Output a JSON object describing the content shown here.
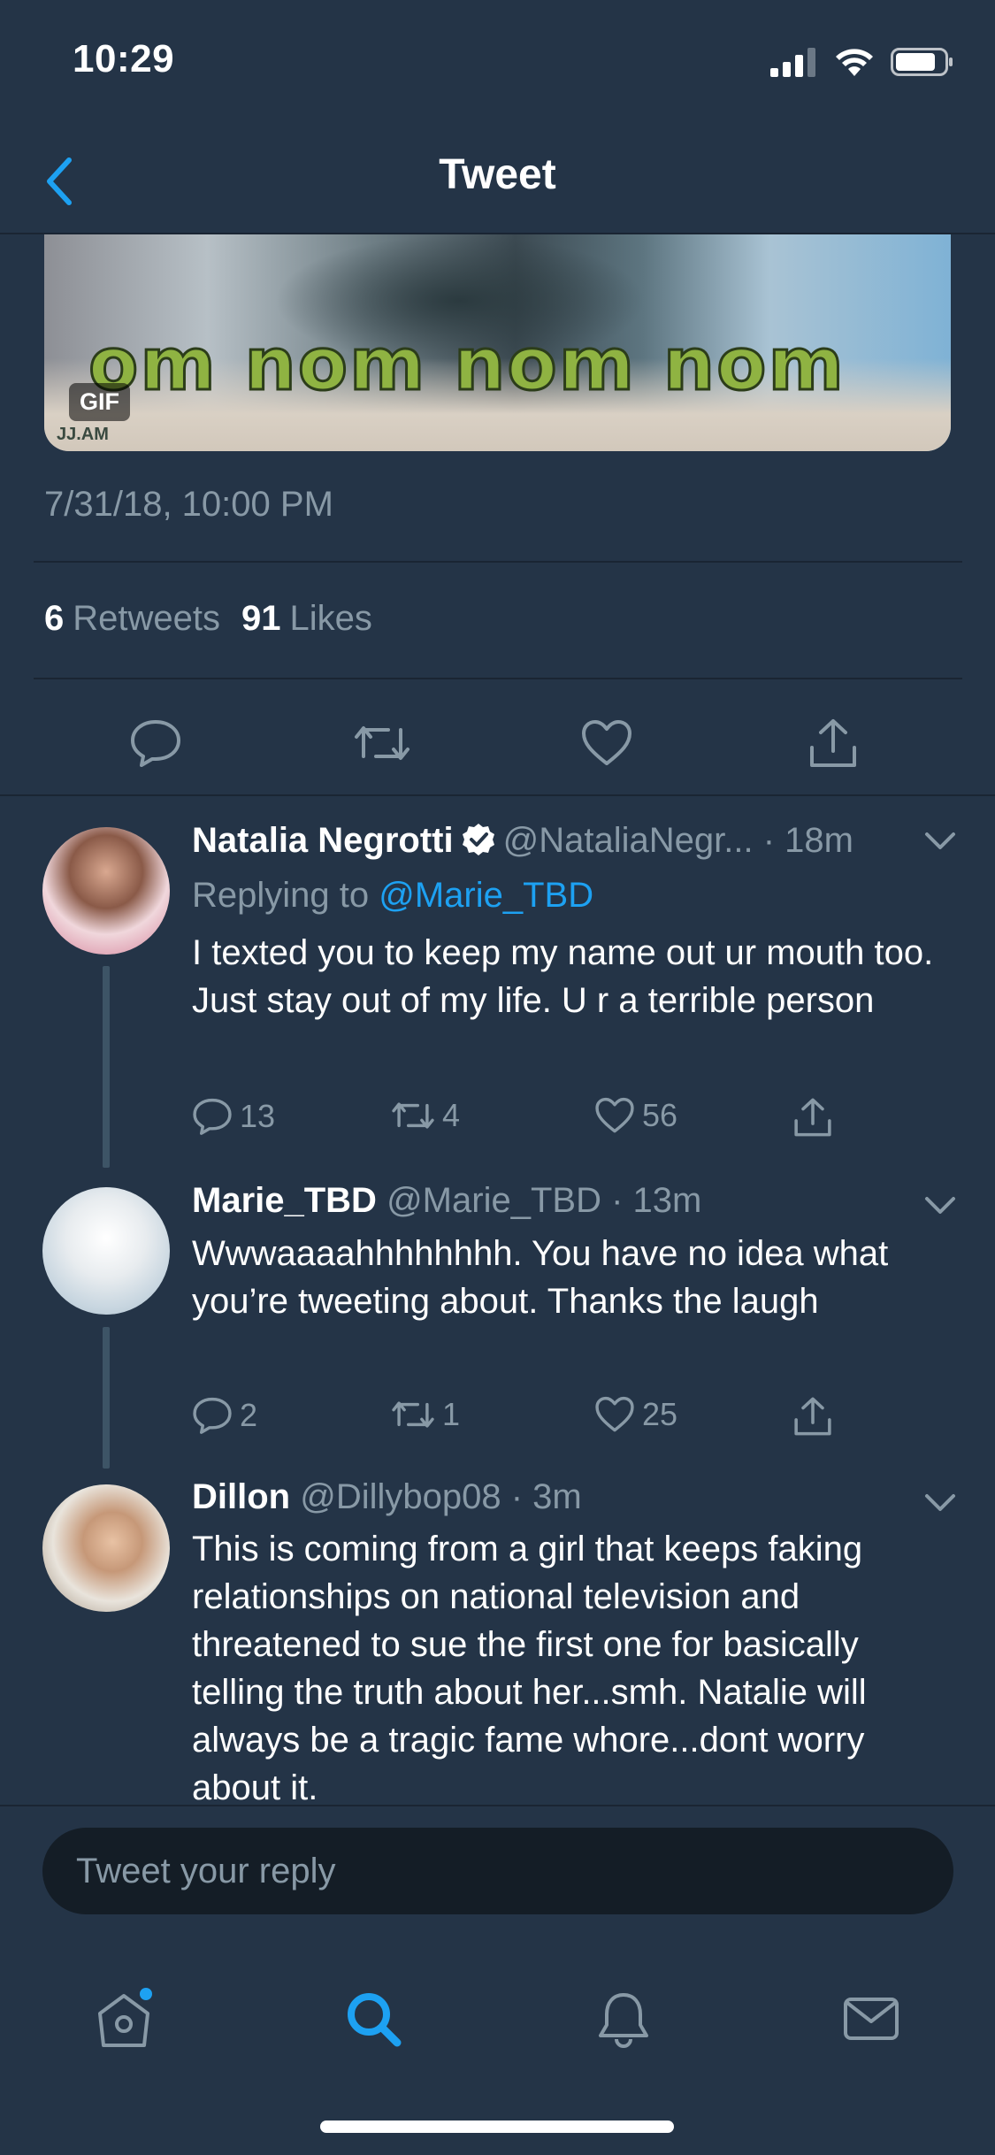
{
  "status_bar": {
    "time": "10:29"
  },
  "nav": {
    "title": "Tweet"
  },
  "media": {
    "caption": "om nom nom nom",
    "badge": "GIF",
    "watermark": "JJ.AM"
  },
  "tweet": {
    "timestamp": "7/31/18, 10:00 PM",
    "retweets_count": "6",
    "retweets_label": "Retweets",
    "likes_count": "91",
    "likes_label": "Likes"
  },
  "replies": [
    {
      "name": "Natalia Negrotti",
      "handle": "@NataliaNegr...",
      "time": "· 18m",
      "replying_prefix": "Replying to",
      "replying_to": "@Marie_TBD",
      "text": "I texted you to keep my name out ur mouth too. Just stay out of my life. U r a terrible person",
      "reply_count": "13",
      "retweet_count": "4",
      "like_count": "56"
    },
    {
      "name": "Marie_TBD",
      "handle": "@Marie_TBD",
      "time": "· 13m",
      "text": "Wwwaaaahhhhhhhh. You have no idea what you’re tweeting about. Thanks the laugh",
      "reply_count": "2",
      "retweet_count": "1",
      "like_count": "25"
    },
    {
      "name": "Dillon",
      "handle": "@Dillybop08",
      "time": "· 3m",
      "text": "This is coming from a girl that keeps faking relationships on national television and threatened to sue the first one for basically telling the truth about her...smh. Natalie will always be a tragic fame whore...dont worry about it."
    }
  ],
  "compose": {
    "placeholder": "Tweet your reply"
  },
  "colors": {
    "background": "#243447",
    "accent": "#1da1f2",
    "muted": "#8899a6",
    "input_bg": "#141d26"
  },
  "icons": [
    "back-chevron-icon",
    "reply-icon",
    "retweet-icon",
    "like-icon",
    "share-icon",
    "verified-icon",
    "caret-down-icon",
    "home-icon",
    "search-icon",
    "notifications-icon",
    "messages-icon"
  ]
}
